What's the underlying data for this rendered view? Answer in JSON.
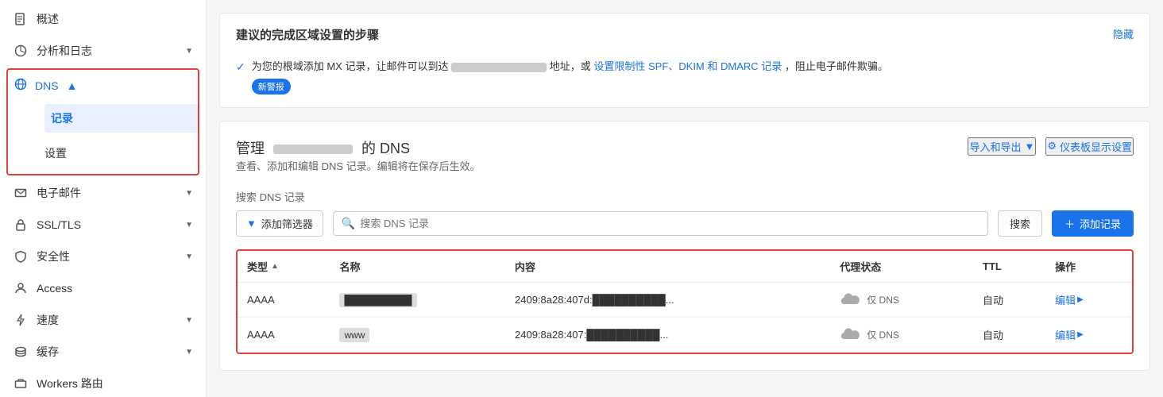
{
  "sidebar": {
    "items": [
      {
        "id": "overview",
        "label": "概述",
        "icon": "doc-icon",
        "hasArrow": false
      },
      {
        "id": "analytics",
        "label": "分析和日志",
        "icon": "chart-icon",
        "hasArrow": true
      },
      {
        "id": "dns",
        "label": "DNS",
        "icon": "dns-icon",
        "hasArrow": true,
        "active": true
      },
      {
        "id": "records",
        "label": "记录",
        "sub": true,
        "active": true
      },
      {
        "id": "settings",
        "label": "设置",
        "sub": true
      },
      {
        "id": "email",
        "label": "电子邮件",
        "icon": "email-icon",
        "hasArrow": true
      },
      {
        "id": "ssl",
        "label": "SSL/TLS",
        "icon": "lock-icon",
        "hasArrow": true
      },
      {
        "id": "security",
        "label": "安全性",
        "icon": "shield-icon",
        "hasArrow": true
      },
      {
        "id": "access",
        "label": "Access",
        "icon": "access-icon",
        "hasArrow": false
      },
      {
        "id": "speed",
        "label": "速度",
        "icon": "lightning-icon",
        "hasArrow": true
      },
      {
        "id": "cache",
        "label": "缓存",
        "icon": "storage-icon",
        "hasArrow": true
      },
      {
        "id": "workers",
        "label": "Workers 路由",
        "icon": "workers-icon",
        "hasArrow": false
      }
    ]
  },
  "banner": {
    "title": "建议的完成区域设置的步骤",
    "hide_label": "隐藏",
    "item_text_pre": "为您的根域添加 MX 记录，让邮件可以到达",
    "item_text_mid": "地址，或",
    "item_link": "设置限制性 SPF、DKIM 和 DMARC 记录",
    "item_text_post": "，阻止电子邮件欺骗。",
    "badge": "新警报"
  },
  "dns_management": {
    "title_pre": "管理",
    "title_post": "的 DNS",
    "subtitle": "查看、添加和编辑 DNS 记录。编辑将在保存后生效。",
    "import_label": "导入和导出",
    "settings_label": "仪表板显示设置",
    "search_placeholder": "搜索 DNS 记录",
    "filter_label": "添加筛选器",
    "search_button": "搜索",
    "add_button": "添加记录",
    "table": {
      "columns": [
        "类型",
        "名称",
        "内容",
        "代理状态",
        "TTL",
        "操作"
      ],
      "rows": [
        {
          "type": "AAAA",
          "name": "██████████",
          "content": "2409:8a28:407d:██████████...",
          "proxy_status": "仅 DNS",
          "ttl": "自动",
          "action": "编辑"
        },
        {
          "type": "AAAA",
          "name": "www",
          "content": "2409:8a28:407:██████████...",
          "proxy_status": "仅 DNS",
          "ttl": "自动",
          "action": "编辑"
        }
      ]
    }
  }
}
